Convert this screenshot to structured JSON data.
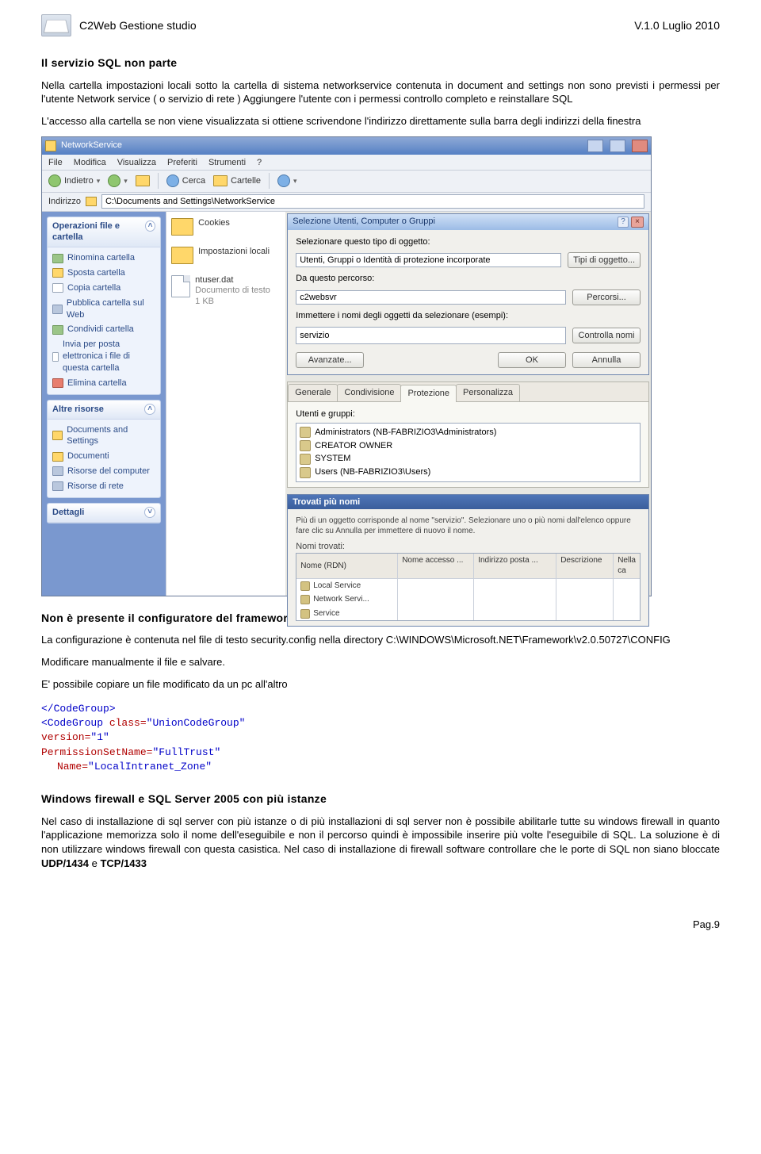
{
  "header": {
    "title": "C2Web Gestione studio",
    "version": "V.1.0 Luglio 2010"
  },
  "section1": {
    "title": "Il servizio SQL non parte",
    "p1": "Nella cartella impostazioni locali sotto la cartella di sistema networkservice contenuta in document and settings non sono previsti i permessi per l'utente Network service ( o servizio di rete ) Aggiungere l'utente con i permessi controllo completo e reinstallare SQL",
    "p2": "L'accesso alla cartella se non viene visualizzata si ottiene scrivendone l'indirizzo direttamente sulla barra degli indirizzi della finestra"
  },
  "shot": {
    "win_title": "NetworkService",
    "menu": {
      "file": "File",
      "modifica": "Modifica",
      "visualizza": "Visualizza",
      "preferiti": "Preferiti",
      "strumenti": "Strumenti",
      "help": "?"
    },
    "tb": {
      "back": "Indietro",
      "search": "Cerca",
      "folders": "Cartelle"
    },
    "addr_label": "Indirizzo",
    "addr_value": "C:\\Documents and Settings\\NetworkService",
    "panel1": {
      "title": "Operazioni file e cartella",
      "items": [
        "Rinomina cartella",
        "Sposta cartella",
        "Copia cartella",
        "Pubblica cartella sul Web",
        "Condividi cartella",
        "Invia per posta elettronica i file di questa cartella",
        "Elimina cartella"
      ]
    },
    "panel2": {
      "title": "Altre risorse",
      "items": [
        "Documents and Settings",
        "Documenti",
        "Risorse del computer",
        "Risorse di rete"
      ]
    },
    "panel3": {
      "title": "Dettagli"
    },
    "files": {
      "cookies": "Cookies",
      "imploc": "Impostazioni locali",
      "ntuser": "ntuser.dat",
      "ntuser_sub1": "Documento di testo",
      "ntuser_sub2": "1 KB"
    },
    "dlg": {
      "title": "Selezione Utenti, Computer o Gruppi",
      "l_type": "Selezionare questo tipo di oggetto:",
      "v_type": "Utenti, Gruppi o Identità di protezione incorporate",
      "b_type": "Tipi di oggetto...",
      "l_from": "Da questo percorso:",
      "v_from": "c2websvr",
      "b_from": "Percorsi...",
      "l_names": "Immettere i nomi degli oggetti da selezionare (esempi):",
      "v_names": "servizio",
      "b_check": "Controlla nomi",
      "b_adv": "Avanzate...",
      "b_ok": "OK",
      "b_cancel": "Annulla"
    },
    "tabs": {
      "gen": "Generale",
      "cond": "Condivisione",
      "prot": "Protezione",
      "pers": "Personalizza",
      "ugruppi": "Utenti e gruppi:"
    },
    "ulist": [
      "Administrators (NB-FABRIZIO3\\Administrators)",
      "CREATOR OWNER",
      "SYSTEM",
      "Users (NB-FABRIZIO3\\Users)"
    ],
    "dlg2": {
      "title": "Trovati più nomi",
      "hint": "Più di un oggetto corrisponde al nome \"servizio\". Selezionare uno o più nomi dall'elenco oppure fare clic su Annulla per immettere di nuovo il nome.",
      "label_found": "Nomi trovati:",
      "cols": {
        "rdn": "Nome (RDN)",
        "acc": "Nome accesso ...",
        "mail": "Indirizzo posta ...",
        "desc": "Descrizione",
        "in": "Nella ca"
      },
      "rows": [
        "Local Service",
        "Network Servi...",
        "Service"
      ]
    }
  },
  "section2": {
    "title": "Non è presente il configuratore del framework",
    "p1a": "La configurazione è contenuta nel file di testo security.config nella directory C:\\WINDOWS\\Microsoft.NET\\Framework\\v2.0.50727\\CONFIG",
    "p2": "Modificare manualmente il file e salvare.",
    "p3": "E' possibile copiare un file modificato da un pc all'altro"
  },
  "code": {
    "l1": "</CodeGroup>",
    "l2_open": "<CodeGroup",
    "l2_class_attr": "class=",
    "l2_class_val": "\"UnionCodeGroup\"",
    "l3_attr": "version=",
    "l3_val": "\"1\"",
    "l4_attr": "PermissionSetName=",
    "l4_val": "\"FullTrust\"",
    "l5_attr": "Name=",
    "l5_val": "\"LocalIntranet_Zone\""
  },
  "section3": {
    "title": "Windows firewall e SQL Server 2005 con più istanze",
    "p1_pre": "Nel caso di installazione di sql server con più istanze o di più installazioni di sql server non è possibile abilitarle tutte su windows firewall in quanto l'applicazione memorizza solo il nome dell'eseguibile e non il percorso quindi è impossibile inserire più volte l'eseguibile di SQL. La soluzione è di non utilizzare windows firewall con questa casistica. Nel caso di installazione di firewall software controllare che le porte di SQL non siano bloccate ",
    "udp": "UDP/1434",
    "and": " e ",
    "tcp": "TCP/1433"
  },
  "footer": {
    "page": "Pag.9"
  }
}
